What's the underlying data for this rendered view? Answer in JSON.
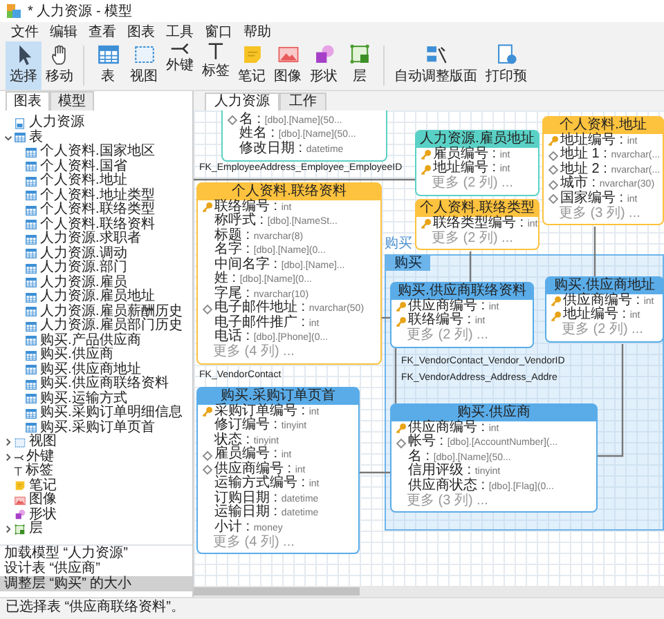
{
  "window": {
    "title": "* 人力资源 - 模型"
  },
  "menu": [
    "文件",
    "编辑",
    "查看",
    "图表",
    "工具",
    "窗口",
    "帮助"
  ],
  "toolbar": [
    {
      "kind": "pointer",
      "label": "选择",
      "selected": true
    },
    {
      "kind": "hand",
      "label": "移动",
      "selected": false
    },
    {
      "kind": "table",
      "label": "表",
      "selected": false
    },
    {
      "kind": "view",
      "label": "视图",
      "selected": false
    },
    {
      "kind": "fk",
      "label": "外键",
      "selected": false
    },
    {
      "kind": "label",
      "label": "标签",
      "selected": false
    },
    {
      "kind": "note",
      "label": "笔记",
      "selected": false
    },
    {
      "kind": "image",
      "label": "图像",
      "selected": false
    },
    {
      "kind": "shape",
      "label": "形状",
      "selected": false
    },
    {
      "kind": "layer",
      "label": "层",
      "selected": false
    },
    {
      "kind": "autolayout",
      "label": "自动调整版面",
      "selected": false
    },
    {
      "kind": "print",
      "label": "打印预",
      "selected": false
    }
  ],
  "sidebar": {
    "tabs": [
      {
        "label": "图表",
        "selected": true
      },
      {
        "label": "模型",
        "selected": false
      }
    ],
    "tree": [
      {
        "kind": "model",
        "label": "人力资源"
      },
      {
        "kind": "table",
        "label": "表",
        "expanded": true,
        "children": [
          {
            "kind": "table",
            "label": "个人资料.国家地区"
          },
          {
            "kind": "table",
            "label": "个人资料.国省"
          },
          {
            "kind": "table",
            "label": "个人资料.地址"
          },
          {
            "kind": "table",
            "label": "个人资料.地址类型"
          },
          {
            "kind": "table",
            "label": "个人资料.联络类型"
          },
          {
            "kind": "table",
            "label": "个人资料.联络资料"
          },
          {
            "kind": "table",
            "label": "人力资源.求职者"
          },
          {
            "kind": "table",
            "label": "人力资源.调动"
          },
          {
            "kind": "table",
            "label": "人力资源.部门"
          },
          {
            "kind": "table",
            "label": "人力资源.雇员"
          },
          {
            "kind": "table",
            "label": "人力资源.雇员地址"
          },
          {
            "kind": "table",
            "label": "人力资源.雇员薪酬历史"
          },
          {
            "kind": "table",
            "label": "人力资源.雇员部门历史"
          },
          {
            "kind": "table",
            "label": "购买.产品供应商"
          },
          {
            "kind": "table",
            "label": "购买.供应商"
          },
          {
            "kind": "table",
            "label": "购买.供应商地址"
          },
          {
            "kind": "table",
            "label": "购买.供应商联络资料"
          },
          {
            "kind": "table",
            "label": "购买.运输方式"
          },
          {
            "kind": "table",
            "label": "购买.采购订单明细信息"
          },
          {
            "kind": "table",
            "label": "购买.采购订单页首"
          }
        ]
      },
      {
        "kind": "view",
        "label": "视图",
        "expanded": false
      },
      {
        "kind": "fk",
        "label": "外键",
        "expanded": false
      },
      {
        "kind": "label",
        "label": "标签"
      },
      {
        "kind": "note",
        "label": "笔记"
      },
      {
        "kind": "image",
        "label": "图像"
      },
      {
        "kind": "shape",
        "label": "形状"
      },
      {
        "kind": "layer",
        "label": "层",
        "expanded": false
      }
    ],
    "history": [
      {
        "label": "加载模型 “人力资源”",
        "selected": false
      },
      {
        "label": "设计表 “供应商”",
        "selected": false
      },
      {
        "label": "调整层 “购买” 的大小",
        "selected": true
      }
    ]
  },
  "canvas_tabs": [
    {
      "label": "人力资源",
      "selected": true
    },
    {
      "label": "工作",
      "selected": false
    }
  ],
  "diagram": {
    "layer": {
      "label": "购买",
      "tab": "购买"
    },
    "tables": [
      {
        "color": "#5ad1c6",
        "rows": [
          {
            "kind": "diamond",
            "name": "名 :",
            "type": "[dbo].[Name](50..."
          },
          {
            "kind": "plain",
            "name": "姓名 :",
            "type": "[dbo].[Name](50..."
          },
          {
            "kind": "plain",
            "name": "修改日期 :",
            "type": "datetime"
          }
        ]
      },
      {
        "title": "人力资源.雇员地址",
        "color": "#5ad1c6",
        "rows": [
          {
            "kind": "key",
            "name": "雇员编号 :",
            "type": "int"
          },
          {
            "kind": "key",
            "name": "地址编号 :",
            "type": "int"
          }
        ],
        "more": "更多 (2 列) ..."
      },
      {
        "title": "个人资料.地址",
        "color": "#fdc23e",
        "rows": [
          {
            "kind": "key",
            "name": "地址编号 :",
            "type": "int"
          },
          {
            "kind": "diamond",
            "name": "地址 1 :",
            "type": "nvarchar(..."
          },
          {
            "kind": "diamond",
            "name": "地址 2 :",
            "type": "nvarchar(..."
          },
          {
            "kind": "diamond",
            "name": "城市 :",
            "type": "nvarchar(30)"
          },
          {
            "kind": "diamond",
            "name": "国家编号 :",
            "type": "int"
          }
        ],
        "more": "更多 (3 列) ..."
      },
      {
        "title": "个人资料.联络资料",
        "color": "#fdc23e",
        "rows": [
          {
            "kind": "key",
            "name": "联络编号 :",
            "type": "int"
          },
          {
            "kind": "plain",
            "name": "称呼式 :",
            "type": "[dbo].[NameSt..."
          },
          {
            "kind": "plain",
            "name": "标题 :",
            "type": "nvarchar(8)"
          },
          {
            "kind": "plain",
            "name": "名字 :",
            "type": "[dbo].[Name](0..."
          },
          {
            "kind": "plain",
            "name": "中间名字 :",
            "type": "[dbo].[Name]..."
          },
          {
            "kind": "plain",
            "name": "姓 :",
            "type": "[dbo].[Name](0..."
          },
          {
            "kind": "plain",
            "name": "字尾 :",
            "type": "nvarchar(10)"
          },
          {
            "kind": "diamond",
            "name": "电子邮件地址 :",
            "type": "nvarchar(50)"
          },
          {
            "kind": "plain",
            "name": "电子邮件推广 :",
            "type": "int"
          },
          {
            "kind": "plain",
            "name": "电话 :",
            "type": "[dbo].[Phone](0..."
          }
        ],
        "more": "更多 (4 列) ..."
      },
      {
        "title": "个人资料.联络类型",
        "color": "#fdc23e",
        "rows": [
          {
            "kind": "key",
            "name": "联络类型编号 :",
            "type": "int"
          }
        ],
        "more": "更多 (2 列) ..."
      },
      {
        "title": "购买.供应商联络资料",
        "color": "#5aace8",
        "rows": [
          {
            "kind": "key",
            "name": "供应商编号 :",
            "type": "int"
          },
          {
            "kind": "key",
            "name": "联络编号 :",
            "type": "int"
          }
        ],
        "more": "更多 (2 列) ..."
      },
      {
        "title": "购买.采购订单页首",
        "color": "#5aace8",
        "rows": [
          {
            "kind": "key",
            "name": "采购订单编号 :",
            "type": "int"
          },
          {
            "kind": "plain",
            "name": "修订编号 :",
            "type": "tinyint"
          },
          {
            "kind": "plain",
            "name": "状态 :",
            "type": "tinyint"
          },
          {
            "kind": "diamond",
            "name": "雇员编号 :",
            "type": "int"
          },
          {
            "kind": "diamond",
            "name": "供应商编号 :",
            "type": "int"
          },
          {
            "kind": "plain",
            "name": "运输方式编号 :",
            "type": "int"
          },
          {
            "kind": "plain",
            "name": "订购日期 :",
            "type": "datetime"
          },
          {
            "kind": "plain",
            "name": "运输日期 :",
            "type": "datetime"
          },
          {
            "kind": "plain",
            "name": "小计 :",
            "type": "money"
          }
        ],
        "more": "更多 (4 列) ..."
      },
      {
        "title": "购买.供应商",
        "color": "#5aace8",
        "rows": [
          {
            "kind": "key",
            "name": "供应商编号 :",
            "type": "int"
          },
          {
            "kind": "diamond",
            "name": "帐号 :",
            "type": "[dbo].[AccountNumber](..."
          },
          {
            "kind": "plain",
            "name": "名 :",
            "type": "[dbo].[Name](50..."
          },
          {
            "kind": "plain",
            "name": "信用评级 :",
            "type": "tinyint"
          },
          {
            "kind": "plain",
            "name": "供应商状态 :",
            "type": "[dbo].[Flag](0..."
          }
        ],
        "more": "更多 (3 列) ..."
      },
      {
        "title": "购买.供应商地址",
        "color": "#5aace8",
        "rows": [
          {
            "kind": "key",
            "name": "供应商编号 :",
            "type": "int"
          },
          {
            "kind": "key",
            "name": "地址编号 :",
            "type": "int"
          }
        ],
        "more": "更多 (2 列) ..."
      }
    ],
    "relations": [
      "FK_EmployeeAddress_Employee_EmployeeID",
      "FK_VendorContact",
      "FK_VendorContact_Vendor_VendorID",
      "FK_VendorAddress_Address_Addre"
    ]
  },
  "status_bar": "已选择表 “供应商联络资料”。"
}
